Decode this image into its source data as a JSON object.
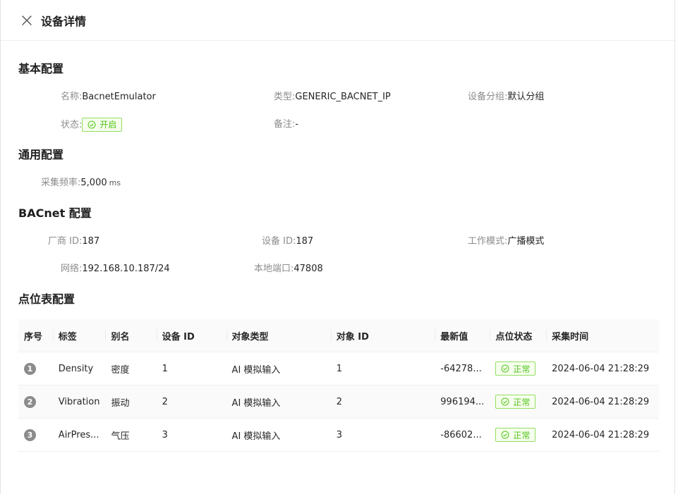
{
  "header": {
    "title": "设备详情"
  },
  "basic": {
    "title": "基本配置",
    "name_label": "名称:",
    "name_value": "BacnetEmulator",
    "type_label": "类型:",
    "type_value": "GENERIC_BACNET_IP",
    "group_label": "设备分组:",
    "group_value": "默认分组",
    "status_label": "状态:",
    "status_value": "开启",
    "remark_label": "备注:",
    "remark_value": "-"
  },
  "general": {
    "title": "通用配置",
    "freq_label": "采集频率:",
    "freq_value": "5,000",
    "freq_unit": "ms"
  },
  "bacnet": {
    "title": "BACnet 配置",
    "vendor_label": "厂商 ID:",
    "vendor_value": "187",
    "device_label": "设备 ID:",
    "device_value": "187",
    "mode_label": "工作模式:",
    "mode_value": "广播模式",
    "network_label": "网络:",
    "network_value": "192.168.10.187/24",
    "port_label": "本地端口:",
    "port_value": "47808"
  },
  "points": {
    "title": "点位表配置",
    "columns": [
      "序号",
      "标签",
      "别名",
      "设备 ID",
      "对象类型",
      "对象 ID",
      "最新值",
      "点位状态",
      "采集时间"
    ],
    "rows": [
      {
        "index": "1",
        "tag": "Density",
        "alias": "密度",
        "device_id": "1",
        "object_type": "AI 模拟输入",
        "object_id": "1",
        "latest": "-64278...",
        "status": "正常",
        "time": "2024-06-04 21:28:29"
      },
      {
        "index": "2",
        "tag": "Vibration",
        "alias": "振动",
        "device_id": "2",
        "object_type": "AI 模拟输入",
        "object_id": "2",
        "latest": "996194...",
        "status": "正常",
        "time": "2024-06-04 21:28:29"
      },
      {
        "index": "3",
        "tag": "AirPres...",
        "alias": "气压",
        "device_id": "3",
        "object_type": "AI 模拟输入",
        "object_id": "3",
        "latest": "-86602...",
        "status": "正常",
        "time": "2024-06-04 21:28:29"
      }
    ]
  },
  "colors": {
    "success": "#52c41a",
    "success_bg": "#f6ffed",
    "index_badge": "#8c8c8c"
  }
}
